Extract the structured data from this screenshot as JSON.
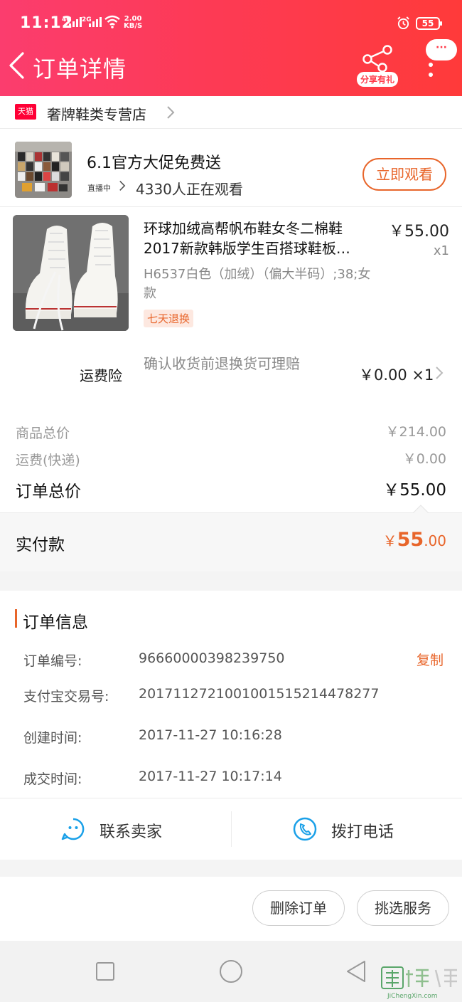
{
  "status_bar": {
    "time": "11:12",
    "signal1": "4G",
    "signal2": "2G",
    "speed_value": "2.00",
    "speed_unit": "KB/S",
    "battery": "55"
  },
  "header": {
    "title": "订单详情",
    "share_label": "分享有礼",
    "bubble_text": "···"
  },
  "store": {
    "badge": "天猫",
    "name": "奢牌鞋类专营店"
  },
  "live": {
    "title": "6.1官方大促免费送",
    "status": "直播中",
    "viewers": "4330人正在观看",
    "button": "立即观看"
  },
  "product": {
    "title_line1": "环球加绒高帮帆布鞋女冬二棉鞋",
    "title_line2": "2017新款韩版学生百搭球鞋板…",
    "price": "￥55.00",
    "quantity": "x1",
    "sku": "H6537白色（加绒）（偏大半码）;38;女款",
    "tag": "七天退换"
  },
  "insurance": {
    "label": "运费险",
    "description": "确认收货前退换货可理赔",
    "price": "￥0.00 ×1"
  },
  "summary": {
    "goods_label": "商品总价",
    "goods_value": "￥214.00",
    "shipping_label": "运费(快递)",
    "shipping_value": "￥0.00",
    "total_label": "订单总价",
    "total_value": "￥55.00",
    "paid_label": "实付款",
    "paid_currency": "￥",
    "paid_int": "55",
    "paid_dec": ".00"
  },
  "order_info": {
    "title": "订单信息",
    "copy_label": "复制",
    "rows": [
      {
        "label": "订单编号:",
        "value": "96660000398239750"
      },
      {
        "label": "支付宝交易号:",
        "value": "2017112721001001515214478277"
      },
      {
        "label": "创建时间:",
        "value": "2017-11-27 10:16:28"
      },
      {
        "label": "成交时间:",
        "value": "2017-11-27 10:17:14"
      }
    ]
  },
  "actions": {
    "contact_seller": "联系卖家",
    "call_phone": "拨打电话"
  },
  "bottom_buttons": {
    "delete_order": "删除订单",
    "pick_service": "挑选服务"
  },
  "watermark": {
    "text": "JiChengXin.com"
  },
  "colors": {
    "header_start": "#fb3d6e",
    "header_end": "#ff3a3a",
    "accent_orange": "#e8652a",
    "icon_blue": "#1aa0e8"
  },
  "icons": [
    "back-arrow-icon",
    "share-icon",
    "more-icon",
    "chevron-right-icon",
    "chat-face-icon",
    "phone-icon",
    "square-nav-icon",
    "circle-nav-icon",
    "triangle-nav-icon"
  ]
}
